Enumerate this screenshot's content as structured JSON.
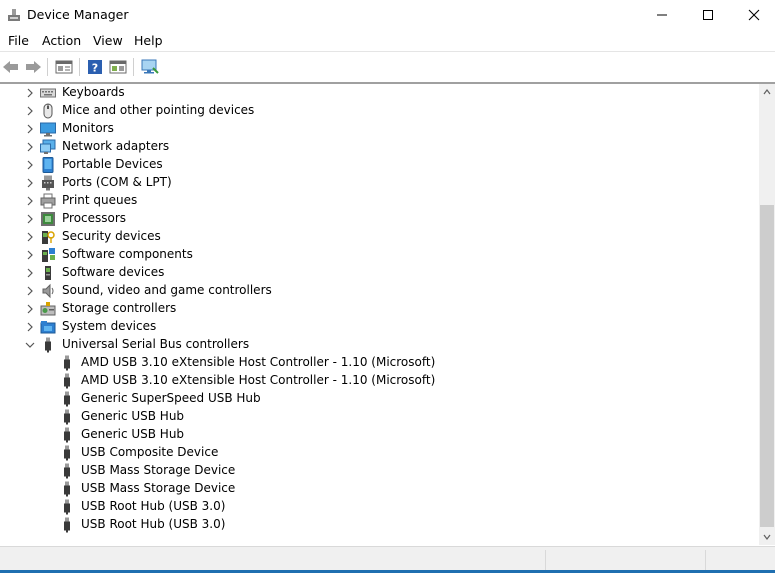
{
  "window": {
    "title": "Device Manager"
  },
  "menu": [
    "File",
    "Action",
    "View",
    "Help"
  ],
  "toolbar": [
    "back-arrow-icon",
    "forward-arrow-icon",
    "properties-icon",
    "help-icon",
    "show-panel-icon",
    "monitor-icon"
  ],
  "colors": {
    "accent": "#1f6fb0",
    "scrollbar_thumb": "#cdcdcd",
    "status_bg": "#f0f0f0"
  },
  "tree": {
    "categories": [
      {
        "label": "Keyboards",
        "icon": "keyboard-icon",
        "expanded": false
      },
      {
        "label": "Mice and other pointing devices",
        "icon": "mouse-icon",
        "expanded": false
      },
      {
        "label": "Monitors",
        "icon": "monitor-icon",
        "expanded": false
      },
      {
        "label": "Network adapters",
        "icon": "network-icon",
        "expanded": false
      },
      {
        "label": "Portable Devices",
        "icon": "portable-device-icon",
        "expanded": false
      },
      {
        "label": "Ports (COM & LPT)",
        "icon": "port-icon",
        "expanded": false
      },
      {
        "label": "Print queues",
        "icon": "printer-icon",
        "expanded": false
      },
      {
        "label": "Processors",
        "icon": "processor-icon",
        "expanded": false
      },
      {
        "label": "Security devices",
        "icon": "security-icon",
        "expanded": false
      },
      {
        "label": "Software components",
        "icon": "software-component-icon",
        "expanded": false
      },
      {
        "label": "Software devices",
        "icon": "software-device-icon",
        "expanded": false
      },
      {
        "label": "Sound, video and game controllers",
        "icon": "speaker-icon",
        "expanded": false
      },
      {
        "label": "Storage controllers",
        "icon": "storage-icon",
        "expanded": false
      },
      {
        "label": "System devices",
        "icon": "system-folder-icon",
        "expanded": false
      },
      {
        "label": "Universal Serial Bus controllers",
        "icon": "usb-icon",
        "expanded": true,
        "children": [
          "AMD USB 3.10 eXtensible Host Controller - 1.10 (Microsoft)",
          "AMD USB 3.10 eXtensible Host Controller - 1.10 (Microsoft)",
          "Generic SuperSpeed USB Hub",
          "Generic USB Hub",
          "Generic USB Hub",
          "USB Composite Device",
          "USB Mass Storage Device",
          "USB Mass Storage Device",
          "USB Root Hub (USB 3.0)",
          "USB Root Hub (USB 3.0)"
        ]
      }
    ]
  }
}
